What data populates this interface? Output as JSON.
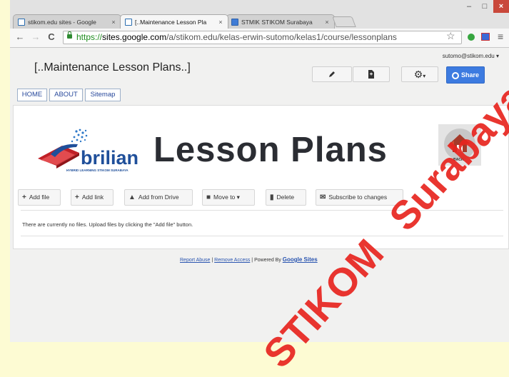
{
  "browser": {
    "tabs": [
      {
        "title": "stikom.edu sites - Google",
        "close": "×"
      },
      {
        "title": "[..Maintenance Lesson Pla",
        "close": "×"
      },
      {
        "title": "STMIK STIKOM Surabaya",
        "close": "×"
      }
    ],
    "url": {
      "scheme": "https://",
      "host": "sites.google.com",
      "path": "/a/stikom.edu/kelas-erwin-sutomo/kelas1/course/lessonplans"
    },
    "window_controls": {
      "minimize": "–",
      "maximize": "□",
      "close": "×"
    }
  },
  "account": {
    "email": "sutomo@stikom.edu ▾"
  },
  "site": {
    "title": "[..Maintenance Lesson Plans..]"
  },
  "header_buttons": {
    "settings_caret": "▾",
    "share_label": "Share"
  },
  "nav_tabs": [
    {
      "label": "HOME"
    },
    {
      "label": "ABOUT"
    },
    {
      "label": "Sitemap"
    }
  ],
  "banner": {
    "logo_text": "brilian",
    "logo_tagline": "HYBRID LEARNING STIKOM SURABAYA",
    "heading": "Lesson Plans",
    "back_label": "BACK"
  },
  "file_actions": [
    {
      "label": "Add file",
      "icon": "plus-icon"
    },
    {
      "label": "Add link",
      "icon": "plus-icon"
    },
    {
      "label": "Add from Drive",
      "icon": "drive-icon"
    },
    {
      "label": "Move to",
      "icon": "folder-icon",
      "caret": "▾"
    },
    {
      "label": "Delete",
      "icon": "trash-icon"
    },
    {
      "label": "Subscribe to changes",
      "icon": "mail-icon"
    }
  ],
  "empty_message": "There are currently no files. Upload files by clicking the \"Add file\" button.",
  "footer": {
    "report_abuse": "Report Abuse",
    "sep1": "|",
    "remove_access": "Remove Access",
    "sep2": "|",
    "powered_by": "Powered By",
    "google_sites": "Google Sites"
  },
  "watermark": {
    "text1": "Surabaya",
    "text2": "STIKOM"
  },
  "colors": {
    "share_blue": "#3d7be0",
    "link_blue": "#2a55b0",
    "close_red": "#c9483b",
    "watermark_red": "#e8251f",
    "heading_dark": "#2b2d33"
  }
}
